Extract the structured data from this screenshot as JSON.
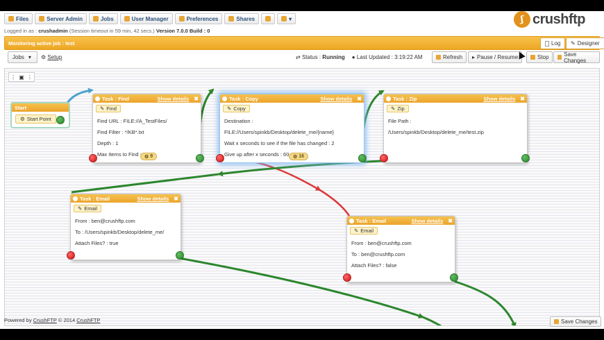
{
  "nav": {
    "items": [
      {
        "label": "Files"
      },
      {
        "label": "Server Admin"
      },
      {
        "label": "Jobs"
      },
      {
        "label": "User Manager"
      },
      {
        "label": "Preferences"
      },
      {
        "label": "Shares"
      },
      {
        "label": ""
      },
      {
        "label": ""
      }
    ]
  },
  "session": {
    "prefix": "Logged in as :",
    "user": "crushadmin",
    "timeout": "(Session timeout in 59 min, 42 secs.)",
    "version": "Version 7.0.0 Build : 0"
  },
  "logo": {
    "mark": "ʃ",
    "text": "crushftp"
  },
  "monitor": {
    "title": "Monitoring active job : test",
    "log_label": "Log",
    "designer_label": "Designer"
  },
  "toolbar": {
    "jobs_label": "Jobs",
    "setup_label": "Setup",
    "status_label": "Status :",
    "status_value": "Running",
    "updated_label": "Last Updated :",
    "updated_value": "3:19:22 AM",
    "refresh_label": "Refresh",
    "pause_label": "Pause / Resume",
    "stop_label": "Stop",
    "save_label": "Save Changes"
  },
  "start_node": {
    "title": "Start",
    "point_label": "Start Point"
  },
  "nodes": {
    "find": {
      "title": "Task : Find",
      "show_details": "Show details",
      "tag": "Find",
      "fields": [
        "Find URL : FILE://A_TestFiles/",
        "Find Filter : */KB*.txt",
        "Depth : 1",
        "Max Items to Find :"
      ],
      "badge": "9"
    },
    "copy": {
      "title": "Task : Copy",
      "show_details": "Show details",
      "tag": "Copy",
      "fields": [
        "Destination :",
        "FILE://Users/spinkb/Desktop/delete_me/{name}",
        "Wait x seconds to see if the file has changed : 2",
        "Give up after x seconds : 60"
      ],
      "badge": "16"
    },
    "zip": {
      "title": "Task : Zip",
      "show_details": "Show details",
      "tag": "Zip",
      "fields": [
        "File Path :",
        "/Users/spinkb/Desktop/delete_me/test.zip"
      ]
    },
    "email1": {
      "title": "Task : Email",
      "show_details": "Show details",
      "tag": "Email",
      "fields": [
        "From : ben@crushftp.com",
        "To : /Users/spinkb/Desktop/delete_me/",
        "Attach Files? : true"
      ]
    },
    "email2": {
      "title": "Task : Email",
      "show_details": "Show details",
      "tag": "Email",
      "fields": [
        "From : ben@crushftp.com",
        "To : ben@crushftp.com",
        "Attach Files? : false"
      ]
    }
  },
  "footer": {
    "powered": "Powered by",
    "brand": "CrushFTP",
    "copyright": "© 2014",
    "brand2": "CrushFTP",
    "save_label": "Save Changes"
  },
  "colors": {
    "accent": "#eea623",
    "link_green": "#2c862c",
    "link_red": "#d93a3a",
    "link_blue": "#4aa0d0"
  }
}
